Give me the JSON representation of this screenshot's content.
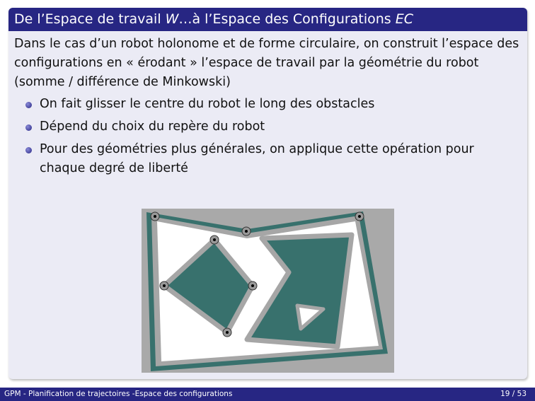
{
  "block": {
    "title_a": "De l’Espace de travail ",
    "title_w": "W",
    "title_b": "…à l’Espace des Configurations ",
    "title_ec": "EC",
    "intro": "Dans le cas d’un robot holonome et de forme circulaire, on construit l’espace des configurations en « érodant » l’espace de travail par la géométrie du robot (somme / différence de Minkowski)",
    "bullets": [
      "On fait glisser le centre du robot le long des obstacles",
      "Dépend du choix du repère du robot",
      "Pour des géométries plus générales, on applique cette opération pour chaque degré de liberté"
    ]
  },
  "colors": {
    "theme": "#272683",
    "obstacle": "#38716d",
    "margin": "#a6a6a6"
  },
  "footer": {
    "title": "GPM - Planification de trajectoires -Espace des configurations",
    "page": "19 / 53"
  }
}
